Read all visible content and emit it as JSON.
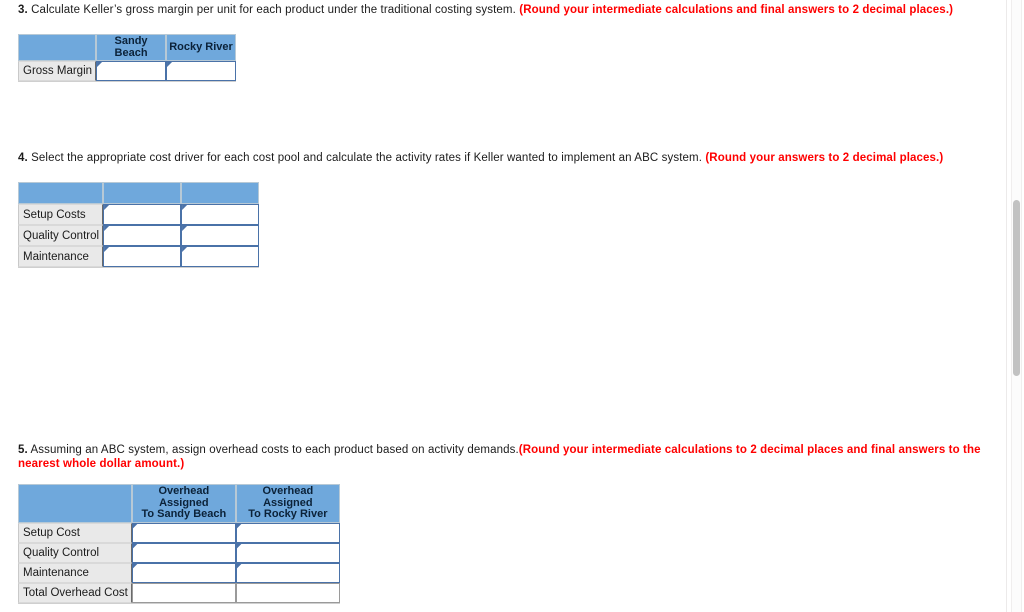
{
  "colors": {
    "header_blue": "#6fa8dc",
    "input_border_blue": "#4a72a8",
    "note_red": "#ff0000",
    "label_grey": "#e9e9e9",
    "scrollbar_thumb": "#c2c2c2"
  },
  "questions": [
    {
      "number": "3.",
      "body": "Calculate Keller’s gross margin per unit for each product under the traditional costing system.",
      "note": "(Round your intermediate calculations and final answers to 2 decimal places.)",
      "table": {
        "headers": [
          "",
          "Sandy Beach",
          "Rocky River"
        ],
        "rows": [
          {
            "label": "Gross Margin",
            "cells": [
              {
                "value": "",
                "type": "input"
              },
              {
                "value": "",
                "type": "input"
              }
            ]
          }
        ]
      }
    },
    {
      "number": "4.",
      "body": "Select the appropriate cost driver for each cost pool and calculate the activity rates if Keller wanted to implement an ABC system.",
      "note": "(Round your answers to 2 decimal places.)",
      "table": {
        "headers": [
          "",
          "",
          ""
        ],
        "rows": [
          {
            "label": "Setup Costs",
            "cells": [
              {
                "value": "",
                "type": "input"
              },
              {
                "value": "",
                "type": "input"
              }
            ]
          },
          {
            "label": "Quality Control",
            "cells": [
              {
                "value": "",
                "type": "input"
              },
              {
                "value": "",
                "type": "input"
              }
            ]
          },
          {
            "label": "Maintenance",
            "cells": [
              {
                "value": "",
                "type": "input"
              },
              {
                "value": "",
                "type": "input"
              }
            ]
          }
        ]
      }
    },
    {
      "number": "5.",
      "body": "Assuming an ABC system, assign overhead costs to each product based on activity demands.",
      "note": "(Round your intermediate calculations to 2 decimal places and final answers to the nearest whole dollar amount.)",
      "table": {
        "headers": [
          "",
          "Overhead Assigned To Sandy Beach",
          "Overhead Assigned To Rocky River"
        ],
        "header_lines": [
          [
            "",
            ""
          ],
          [
            "Overhead Assigned",
            "To Sandy Beach"
          ],
          [
            "Overhead Assigned",
            "To Rocky River"
          ]
        ],
        "rows": [
          {
            "label": "Setup Cost",
            "cells": [
              {
                "value": "",
                "type": "input"
              },
              {
                "value": "",
                "type": "input"
              }
            ]
          },
          {
            "label": "Quality Control",
            "cells": [
              {
                "value": "",
                "type": "input"
              },
              {
                "value": "",
                "type": "input"
              }
            ]
          },
          {
            "label": "Maintenance",
            "cells": [
              {
                "value": "",
                "type": "input"
              },
              {
                "value": "",
                "type": "input"
              }
            ]
          },
          {
            "label": "Total Overhead Cost",
            "cells": [
              {
                "value": "",
                "type": "total"
              },
              {
                "value": "",
                "type": "total"
              }
            ]
          }
        ]
      }
    }
  ],
  "scrollbar": {
    "name": "vertical-scrollbar"
  }
}
